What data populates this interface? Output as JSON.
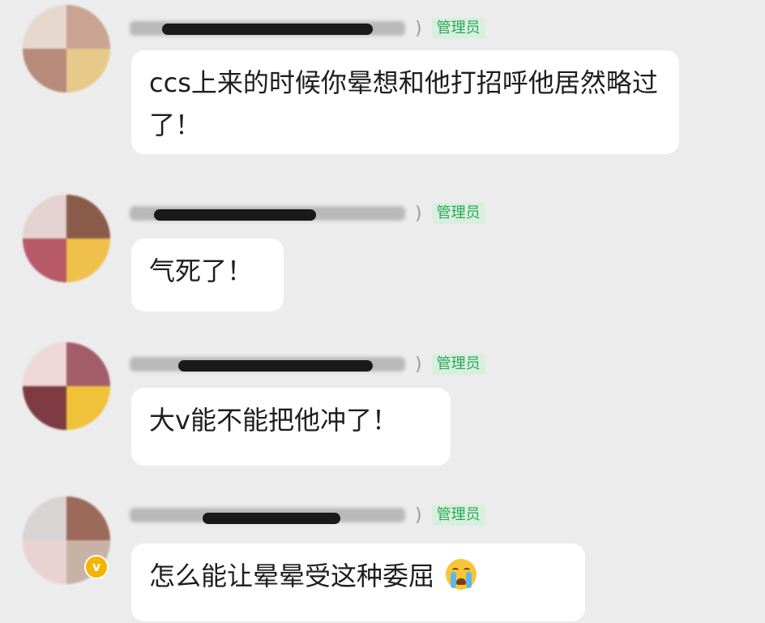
{
  "messages": [
    {
      "badge": "管理员",
      "text": "ccs上来的时候你晕想和他打招呼他居然略过了！"
    },
    {
      "badge": "管理员",
      "text": "气死了！"
    },
    {
      "badge": "管理员",
      "text": "大v能不能把他冲了！"
    },
    {
      "badge": "管理员",
      "text": "怎么能让晕晕受这种委屈",
      "emoji": "loudly-crying-face",
      "verified": true
    }
  ],
  "colors": {
    "background": "#ececec",
    "bubble": "#ffffff",
    "badge_bg": "#d9efdd",
    "badge_text": "#29a85a"
  }
}
